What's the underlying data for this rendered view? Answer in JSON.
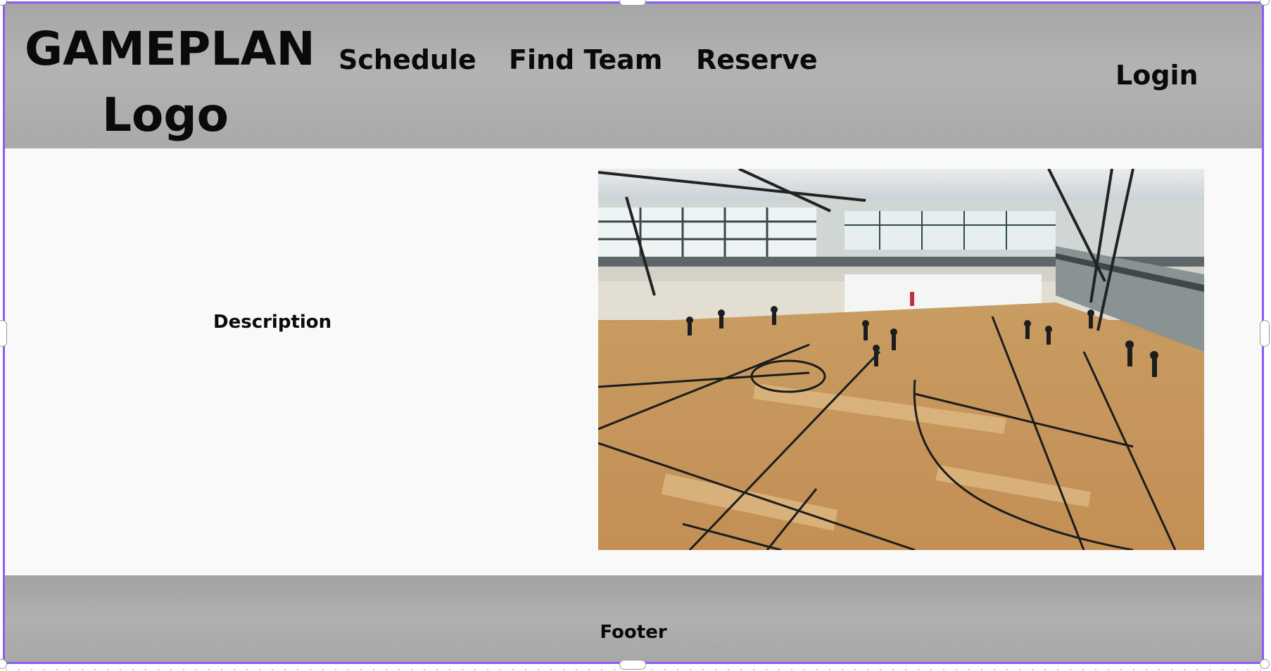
{
  "header": {
    "logo_line1": "GAMEPLAN",
    "logo_line2": "Logo",
    "nav": {
      "schedule": "Schedule",
      "find_team": "Find Team",
      "reserve": "Reserve"
    },
    "login": "Login"
  },
  "main": {
    "description": "Description",
    "image": "gym-basketball-court-photo"
  },
  "footer": {
    "text": "Footer"
  },
  "colors": {
    "selection_border": "#8b5cf6",
    "bar_gray": "#aaaaaa",
    "body_bg": "#f9f9f9"
  }
}
